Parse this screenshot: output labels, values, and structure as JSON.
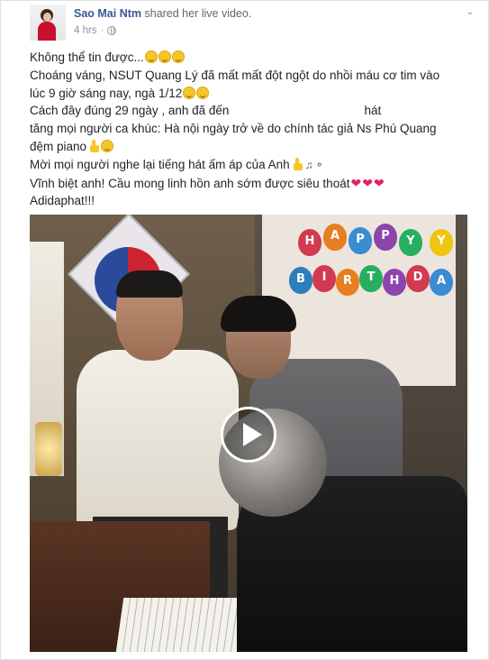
{
  "post": {
    "author": "Sao Mai Ntm",
    "action": " shared her live video.",
    "time": "4 hrs",
    "privacy_icon": "globe-icon",
    "menu_icon": "chevron-down-icon"
  },
  "message": {
    "line1": "Không thể tin được...",
    "line2": "Choáng váng, NSUT Quang Lý đã mất mất đột ngột do nhồi máu cơ tim vào",
    "line3": "lúc 9 giờ sáng nay, ngà 1/12",
    "line4_a": "Cách đây đúng 29 ngày , anh đã đến",
    "line4_b": "hát",
    "line5": "tăng mọi người ca khúc: Hà nội ngày trở về do chính tác giả Ns Phú Quang",
    "line6": "đệm piano",
    "line7": "Mời mọi người nghe lại tiếng hát ấm áp của Anh",
    "line8": "Vĩnh biệt anh! Cầu mong linh hồn anh sớm được siêu thoát",
    "line9": "Adidaphat!!!"
  },
  "video": {
    "banner_letters": [
      "H",
      "A",
      "P",
      "P",
      "Y",
      "B",
      "I",
      "R",
      "T",
      "H",
      "D",
      "A",
      "Y"
    ],
    "play_icon": "play-icon"
  },
  "colors": {
    "link": "#365899",
    "meta": "#90949c",
    "text": "#1d2129"
  }
}
